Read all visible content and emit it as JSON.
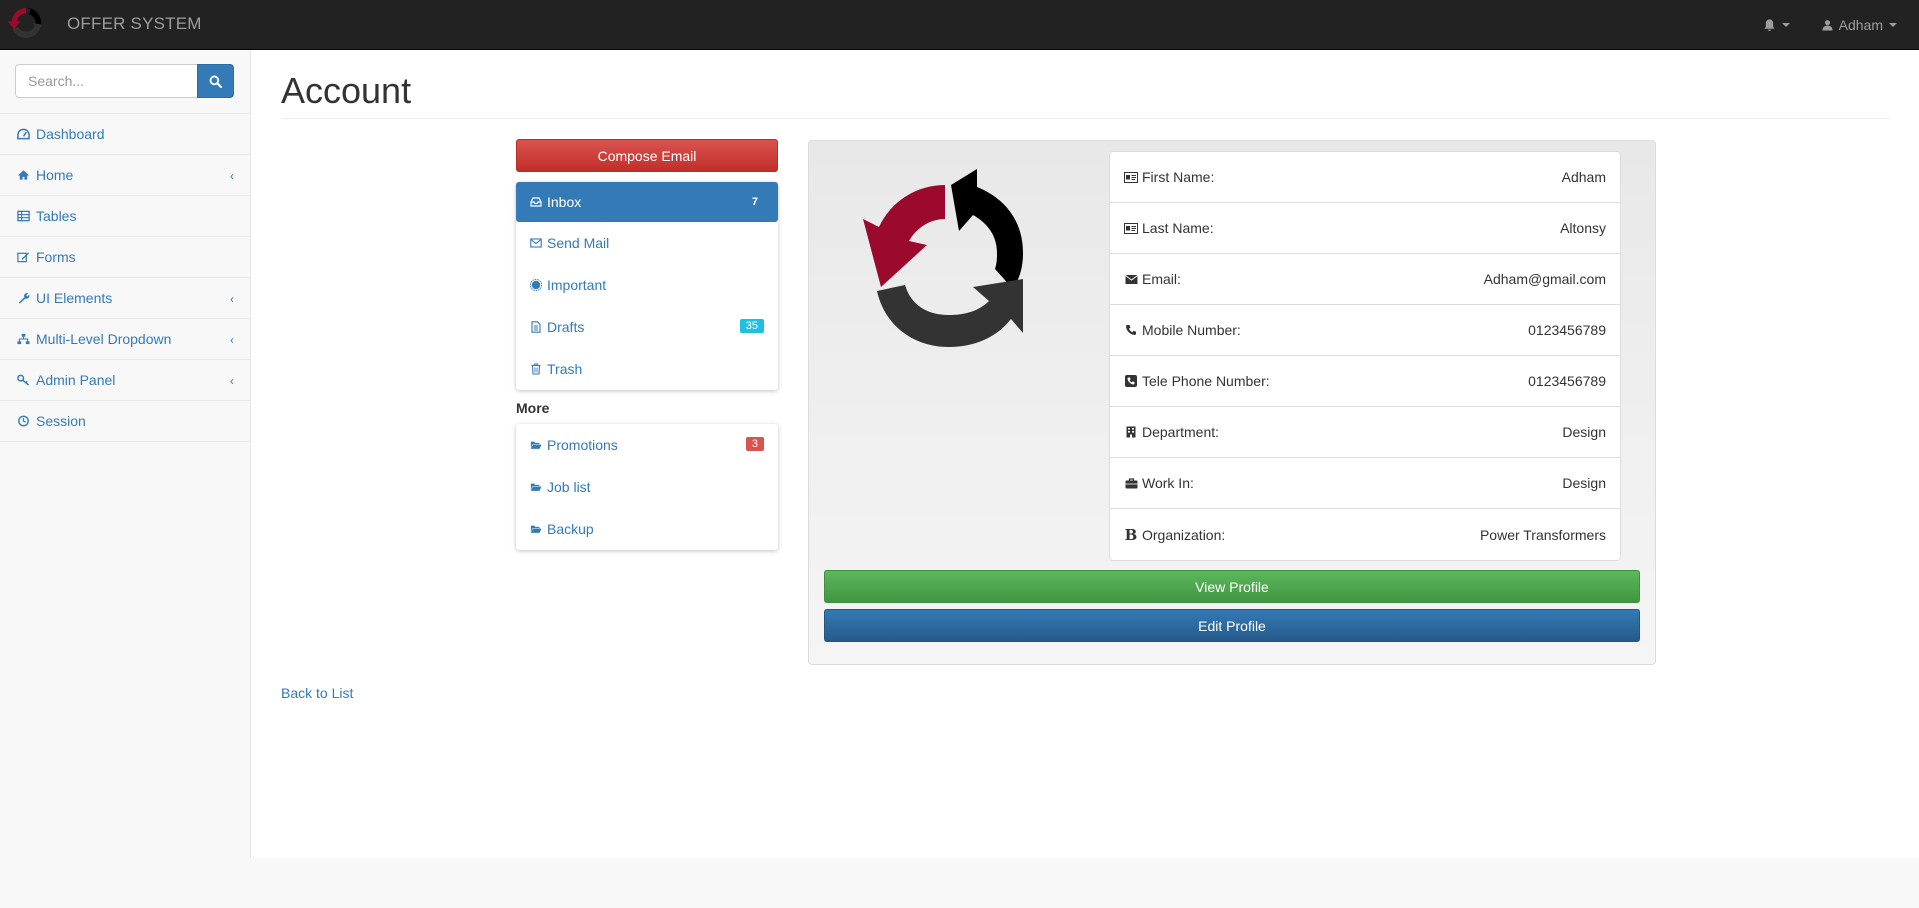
{
  "app": {
    "brand": "OFFER SYSTEM",
    "user_name": "Adham",
    "logo_icon": "refresh-arrows-logo"
  },
  "colors": {
    "navbar": "#222222",
    "primary": "#337ab7",
    "danger": "#d9534f",
    "success": "#5cb85c",
    "info": "#1ec1e4",
    "logo_red": "#9b0a2d",
    "logo_dark": "#333333"
  },
  "sidebar": {
    "search_placeholder": "Search...",
    "items": [
      {
        "label": "Dashboard",
        "icon": "dashboard-icon",
        "has_submenu": false
      },
      {
        "label": "Home",
        "icon": "home-icon",
        "has_submenu": true
      },
      {
        "label": "Tables",
        "icon": "table-icon",
        "has_submenu": false
      },
      {
        "label": "Forms",
        "icon": "edit-icon",
        "has_submenu": false
      },
      {
        "label": "UI Elements",
        "icon": "wrench-icon",
        "has_submenu": true
      },
      {
        "label": "Multi-Level Dropdown",
        "icon": "sitemap-icon",
        "has_submenu": true
      },
      {
        "label": "Admin Panel",
        "icon": "key-icon",
        "has_submenu": true
      },
      {
        "label": "Session",
        "icon": "clock-icon",
        "has_submenu": false
      }
    ]
  },
  "page": {
    "title": "Account",
    "back_link": "Back to List"
  },
  "mail": {
    "compose_label": "Compose Email",
    "folders": [
      {
        "label": "Inbox",
        "badge": "7",
        "icon": "inbox-icon"
      },
      {
        "label": "Send Mail",
        "badge": "",
        "icon": "envelope-icon"
      },
      {
        "label": "Important",
        "badge": "",
        "icon": "certificate-icon"
      },
      {
        "label": "Drafts",
        "badge": "35",
        "icon": "file-icon"
      },
      {
        "label": "Trash",
        "badge": "",
        "icon": "trash-icon"
      }
    ],
    "more_label": "More",
    "more_folders": [
      {
        "label": "Promotions",
        "badge": "3",
        "icon": "folder-open-icon"
      },
      {
        "label": "Job list",
        "badge": "",
        "icon": "folder-open-icon"
      },
      {
        "label": "Backup",
        "badge": "",
        "icon": "folder-open-icon"
      }
    ]
  },
  "profile": {
    "fields": [
      {
        "label": "First Name:",
        "value": "Adham",
        "icon": "id-card-icon"
      },
      {
        "label": "Last Name:",
        "value": "Altonsy",
        "icon": "id-card-icon"
      },
      {
        "label": "Email:",
        "value": "Adham@gmail.com",
        "icon": "envelope-icon"
      },
      {
        "label": "Mobile Number:",
        "value": "0123456789",
        "icon": "phone-icon"
      },
      {
        "label": "Tele Phone Number:",
        "value": "0123456789",
        "icon": "phone-square-icon"
      },
      {
        "label": "Department:",
        "value": "Design",
        "icon": "building-icon"
      },
      {
        "label": "Work In:",
        "value": "Design",
        "icon": "briefcase-icon"
      },
      {
        "label": "Organization:",
        "value": "Power Transformers",
        "icon": "bold-icon"
      }
    ],
    "view_label": "View Profile",
    "edit_label": "Edit Profile"
  }
}
